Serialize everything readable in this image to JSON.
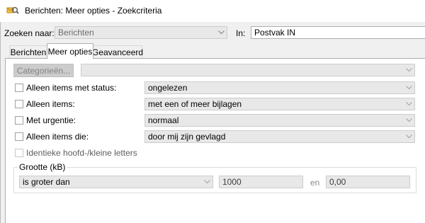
{
  "window": {
    "title": "Berichten: Meer opties - Zoekcriteria"
  },
  "search": {
    "label": "Zoeken naar:",
    "value": "Berichten",
    "in_label": "In:",
    "in_value": "Postvak IN"
  },
  "tabs": [
    {
      "label": "Berichten",
      "active": false
    },
    {
      "label": "Meer opties",
      "active": true
    },
    {
      "label": "Geavanceerd",
      "active": false
    }
  ],
  "more_options": {
    "categories_button": "Categorieën...",
    "categories_value": "",
    "status": {
      "label": "Alleen items met status:",
      "value": "ongelezen"
    },
    "items": {
      "label": "Alleen items:",
      "value": "met een of meer bijlagen"
    },
    "urgency": {
      "label": "Met urgentie:",
      "value": "normaal"
    },
    "items_that": {
      "label": "Alleen items die:",
      "value": "door mij zijn gevlagd"
    },
    "match_case": {
      "label": "Identieke hoofd-/kleine letters"
    }
  },
  "size": {
    "group_title": "Grootte (kB)",
    "condition": "is groter dan",
    "value1": "1000",
    "and_label": "en",
    "value2": "0,00"
  },
  "icons": {
    "app": "outlook-search-icon",
    "dropdown": "chevron-down-icon"
  },
  "colors": {
    "window_bg": "#f0f0f0",
    "panel_bg": "#ffffff",
    "disabled_bg": "#e8e8e8"
  }
}
